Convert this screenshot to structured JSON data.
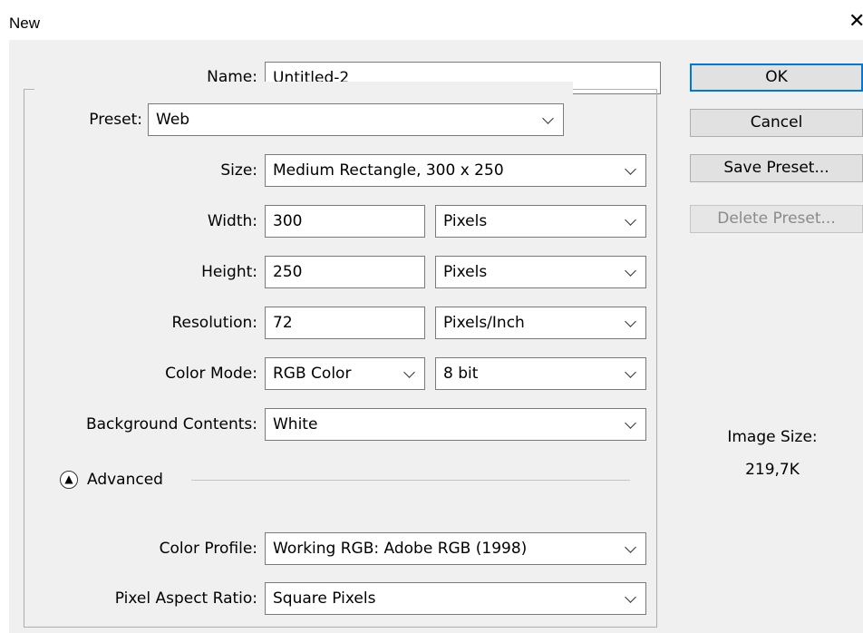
{
  "dialog": {
    "title": "New",
    "close_icon": "close-icon"
  },
  "form": {
    "name_label": "Name:",
    "name_value": "Untitled-2",
    "preset_label": "Preset:",
    "preset_value": "Web",
    "size_label": "Size:",
    "size_value": "Medium Rectangle, 300 x 250",
    "width_label": "Width:",
    "width_value": "300",
    "width_unit": "Pixels",
    "height_label": "Height:",
    "height_value": "250",
    "height_unit": "Pixels",
    "resolution_label": "Resolution:",
    "resolution_value": "72",
    "resolution_unit": "Pixels/Inch",
    "color_mode_label": "Color Mode:",
    "color_mode_value": "RGB Color",
    "bit_depth_value": "8 bit",
    "background_label": "Background Contents:",
    "background_value": "White",
    "advanced_label": "Advanced",
    "color_profile_label": "Color Profile:",
    "color_profile_value": "Working RGB:  Adobe RGB (1998)",
    "pixel_aspect_label": "Pixel Aspect Ratio:",
    "pixel_aspect_value": "Square Pixels"
  },
  "buttons": {
    "ok": "OK",
    "cancel": "Cancel",
    "save_preset": "Save Preset...",
    "delete_preset": "Delete Preset..."
  },
  "info": {
    "image_size_label": "Image Size:",
    "image_size_value": "219,7K"
  },
  "colors": {
    "accent": "#0078d7",
    "dialog_bg": "#f0f0f0",
    "field_border": "#7a7a7a"
  }
}
